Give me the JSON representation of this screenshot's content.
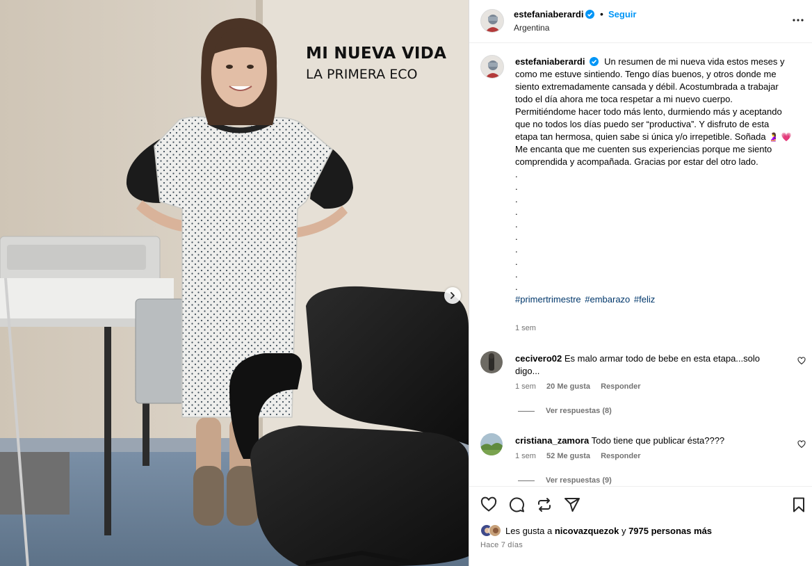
{
  "overlay": {
    "title": "MI NUEVA VIDA",
    "subtitle": "LA PRIMERA ECO"
  },
  "header": {
    "username": "estefaniaberardi",
    "separator": "•",
    "follow_label": "Seguir",
    "location": "Argentina",
    "more_icon": "more-horizontal-icon"
  },
  "caption": {
    "username": "estefaniaberardi",
    "text": "Un resumen de mi nueva vida estos meses y como me estuve sintiendo. Tengo días buenos, y otros donde me siento extremadamente cansada y débil. Acostumbrada a trabajar todo el día ahora me toca respetar a mi nuevo cuerpo. Permitiéndome hacer todo más lento, durmiendo más y aceptando que no todos los días puedo ser “productiva”. Y disfruto de esta etapa tan hermosa, quien sabe si única y/o irrepetible. Soñada",
    "emoji_1": "🤰",
    "emoji_2": "💗",
    "text_2": "Me encanta que me cuenten sus experiencias porque me siento comprendida y acompañada. Gracias por estar del otro lado.",
    "dots": [
      ".",
      ".",
      ".",
      ".",
      ".",
      ".",
      ".",
      ".",
      ".",
      "."
    ],
    "hashtags": [
      "#primertrimestre",
      "#embarazo",
      "#feliz"
    ],
    "time": "1 sem"
  },
  "comments": [
    {
      "username": "cecivero02",
      "text": "Es malo armar todo de bebe en esta etapa...solo digo...",
      "time": "1 sem",
      "likes": "20 Me gusta",
      "reply_label": "Responder",
      "view_replies": "Ver respuestas (8)"
    },
    {
      "username": "cristiana_zamora",
      "text": "Todo tiene que publicar ésta????",
      "time": "1 sem",
      "likes": "52 Me gusta",
      "reply_label": "Responder",
      "view_replies": "Ver respuestas (9)"
    }
  ],
  "actions": {
    "icons": [
      "heart-icon",
      "comment-icon",
      "repost-icon",
      "share-icon",
      "bookmark-icon"
    ]
  },
  "likes": {
    "prefix": "Les gusta a",
    "user": "nicovazquezok",
    "conj": "y",
    "others": "7975 personas más"
  },
  "posted": "Hace 7 días",
  "colors": {
    "link_blue": "#0095f6",
    "hashtag": "#00376b",
    "muted": "#737373",
    "verified": "#0095f6",
    "heart_emoji": "#e0245e"
  }
}
